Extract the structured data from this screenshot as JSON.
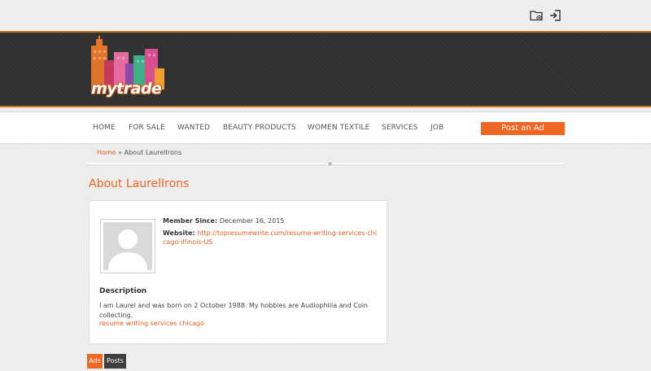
{
  "top_icons": [
    "folder-plus-icon",
    "login-icon"
  ],
  "logo": {
    "text": "mytrade"
  },
  "nav": {
    "items": [
      "HOME",
      "FOR SALE",
      "WANTED",
      "BEAUTY PRODUCTS",
      "WOMEN TEXTILE",
      "SERVICES",
      "JOB"
    ],
    "post_ad": "Post an Ad"
  },
  "breadcrumb": {
    "home": "Home",
    "separator": "»",
    "current": "About LaurelIrons"
  },
  "page": {
    "title": "About LaurelIrons"
  },
  "profile": {
    "member_since_label": "Member Since:",
    "member_since": "December 16, 2015",
    "website_label": "Website:",
    "website": "http://topresumewrite.com/resume-writing-services-chicago-illinois-US",
    "description_title": "Description",
    "description": "I am Laurel and was born on 2 October 1988. My hobbies are Audiophilia and Coin collecting.",
    "description_link": "resume writing services chicago"
  },
  "tabs": [
    "Ads",
    "Posts"
  ],
  "colors": {
    "accent": "#f16522",
    "header_bg": "#2e2e2e",
    "tab_dark": "#3d3d3d"
  }
}
